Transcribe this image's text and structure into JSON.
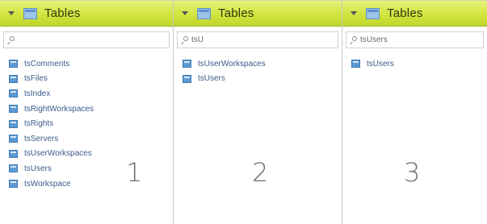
{
  "panels": [
    {
      "header": {
        "title": "Tables"
      },
      "search": {
        "value": ""
      },
      "items": [
        "tsComments",
        "tsFiles",
        "tsIndex",
        "tsRightWorkspaces",
        "tsRights",
        "tsServers",
        "tsUserWorkspaces",
        "tsUsers",
        "tsWorkspace"
      ],
      "number": "1"
    },
    {
      "header": {
        "title": "Tables"
      },
      "search": {
        "value": "tsU"
      },
      "items": [
        "tsUserWorkspaces",
        "tsUsers"
      ],
      "number": "2"
    },
    {
      "header": {
        "title": "Tables"
      },
      "search": {
        "value": "tsUsers"
      },
      "items": [
        "tsUsers"
      ],
      "number": "3"
    }
  ],
  "icons": {
    "collapse": "caret-down-icon",
    "header": "table-icon",
    "search": "search-icon",
    "item": "table-icon"
  },
  "colors": {
    "header_bg": "#cfe33a",
    "item_text": "#3c5b8a",
    "table_icon": "#5b9bd5"
  }
}
